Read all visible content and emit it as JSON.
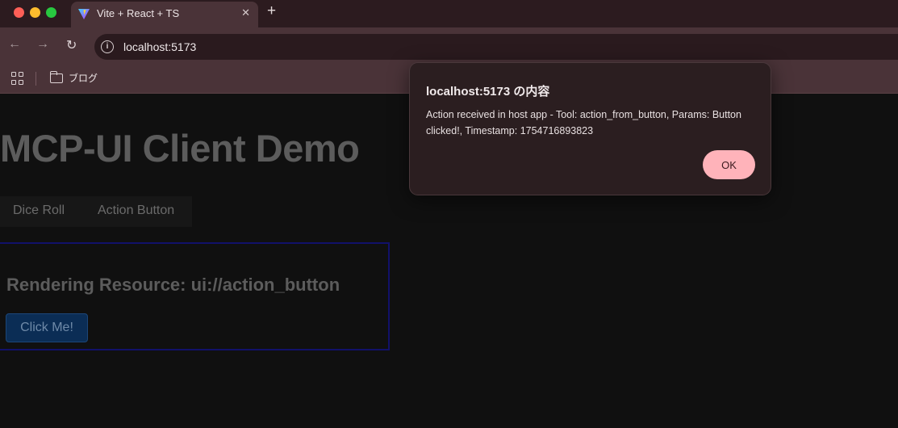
{
  "browser": {
    "tab": {
      "title": "Vite + React + TS",
      "close_glyph": "✕"
    },
    "new_tab_glyph": "+",
    "nav": {
      "back_glyph": "←",
      "forward_glyph": "→",
      "reload_glyph": "↻"
    },
    "address": {
      "url": "localhost:5173",
      "info_glyph": "i"
    },
    "bookmarks": [
      {
        "label": "ブログ"
      }
    ]
  },
  "page": {
    "title": "MCP-UI Client Demo",
    "tabs": [
      {
        "label": "Dice Roll"
      },
      {
        "label": "Action Button"
      }
    ],
    "resource": {
      "heading": "Rendering Resource: ui://action_button",
      "button_label": "Click Me!"
    }
  },
  "dialog": {
    "title": "localhost:5173 の内容",
    "message": "Action received in host app - Tool: action_from_button, Params: Button clicked!, Timestamp: 1754716893823",
    "ok_label": "OK"
  },
  "colors": {
    "accent": "#ffb3ba",
    "chrome": "#4a3338",
    "tabstrip": "#2c1b1f"
  }
}
